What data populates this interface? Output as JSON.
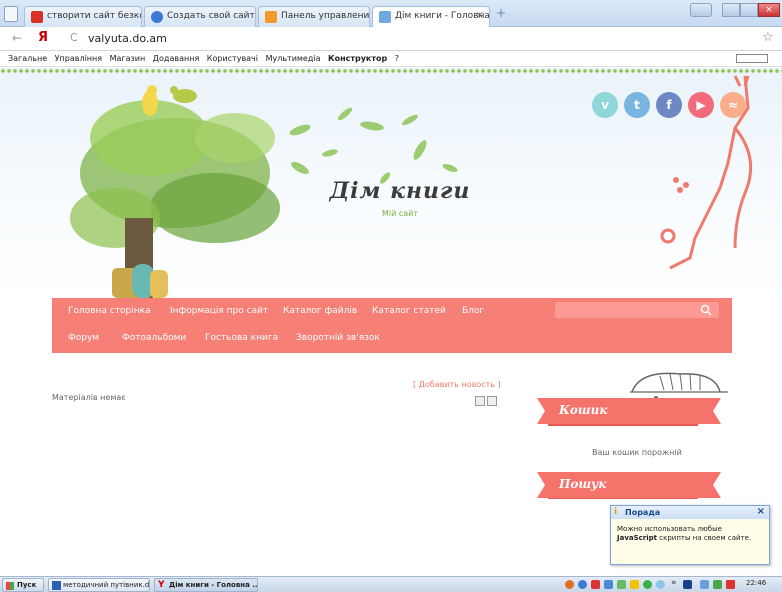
{
  "browser": {
    "tabs": [
      {
        "label": "створити сайт безкошт",
        "active": false,
        "fav_color": "#d93025"
      },
      {
        "label": "Создать свой сайт - uC",
        "active": false,
        "fav_color": "#3a7bd5"
      },
      {
        "label": "Панель управления [va",
        "active": false,
        "fav_color": "#f39a2b"
      },
      {
        "label": "Дім книги - Головна сто",
        "active": true,
        "fav_color": "#6fa8dc"
      }
    ],
    "new_tab": "+",
    "tab_close": "×",
    "back": "←",
    "yandex_logo": "Я",
    "reload": "C",
    "url": "valyuta.do.am",
    "bookmark": "☆"
  },
  "ucoz_bar": {
    "items": [
      "Загальне",
      "Управління",
      "Магазин",
      "Додавання",
      "Користувачі",
      "Мультимедіа"
    ],
    "bold_item": "Конструктор",
    "help": "?"
  },
  "header": {
    "title": "Дім книги",
    "subtitle": "Мій сайт",
    "social": [
      {
        "name": "vimeo-icon",
        "glyph": "v",
        "color": "#8fd6d9"
      },
      {
        "name": "twitter-icon",
        "glyph": "t",
        "color": "#7ab4e0"
      },
      {
        "name": "facebook-icon",
        "glyph": "f",
        "color": "#6d88c3"
      },
      {
        "name": "youtube-icon",
        "glyph": "▶",
        "color": "#f26b7a"
      },
      {
        "name": "rss-icon",
        "glyph": "≈",
        "color": "#f9ad8a"
      }
    ]
  },
  "nav": {
    "row1": [
      "Головна сторінка",
      "Інформація про сайт",
      "Каталог файлів",
      "Каталог статей",
      "Блог"
    ],
    "row2": [
      "Форум",
      "Фотоальбоми",
      "Гостьова книга",
      "Зворотній зв'язок"
    ],
    "search_placeholder": ""
  },
  "content": {
    "empty_message": "Матеріалів немає",
    "add_news": "[ Добавить новость ]"
  },
  "sidebar": {
    "cart_title": "Кошик",
    "cart_empty": "Ваш кошик порожній",
    "search_title": "Пошук"
  },
  "popup": {
    "title": "Порада",
    "text_before": "Можно использовать любые",
    "text_bold": "JavaScript",
    "text_after": "скрипты на своем сайте.",
    "close": "×"
  },
  "taskbar": {
    "start": "Пуск",
    "buttons": [
      "методичний путівник.d...",
      "Дім книги - Головна ..."
    ],
    "more": "»",
    "time": "22:46"
  }
}
